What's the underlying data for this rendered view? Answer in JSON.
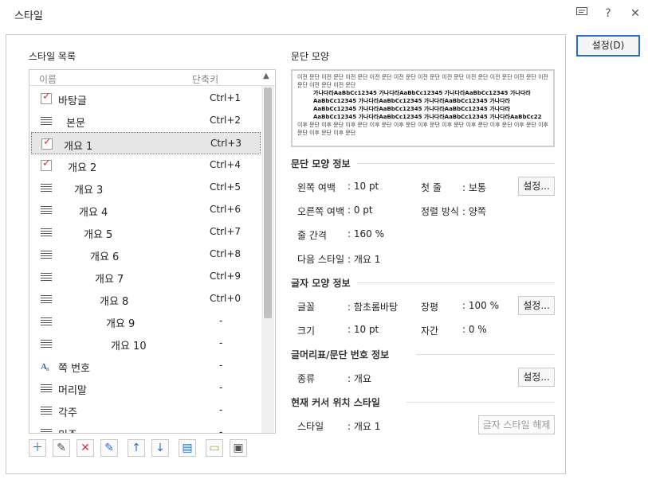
{
  "window": {
    "title": "스타일",
    "help_label": "?",
    "close_label": "✕"
  },
  "ok_button": "설정(D)",
  "style_list": {
    "heading": "스타일 목록",
    "col_name": "이름",
    "col_shortcut": "단축키",
    "items": [
      {
        "name": "바탕글",
        "shortcut": "Ctrl+1",
        "icon": "checkbox-icon"
      },
      {
        "name": "본문",
        "shortcut": "Ctrl+2",
        "icon": "paragraph-icon"
      },
      {
        "name": "개요 1",
        "shortcut": "Ctrl+3",
        "icon": "checkbox-icon",
        "selected": true
      },
      {
        "name": "개요 2",
        "shortcut": "Ctrl+4",
        "icon": "checkbox-icon"
      },
      {
        "name": "개요 3",
        "shortcut": "Ctrl+5",
        "icon": "paragraph-icon"
      },
      {
        "name": "개요 4",
        "shortcut": "Ctrl+6",
        "icon": "paragraph-icon"
      },
      {
        "name": "개요 5",
        "shortcut": "Ctrl+7",
        "icon": "paragraph-icon"
      },
      {
        "name": "개요 6",
        "shortcut": "Ctrl+8",
        "icon": "paragraph-icon"
      },
      {
        "name": "개요 7",
        "shortcut": "Ctrl+9",
        "icon": "paragraph-icon"
      },
      {
        "name": "개요 8",
        "shortcut": "Ctrl+0",
        "icon": "paragraph-icon"
      },
      {
        "name": "개요 9",
        "shortcut": "-",
        "icon": "paragraph-icon"
      },
      {
        "name": "개요 10",
        "shortcut": "-",
        "icon": "paragraph-icon"
      },
      {
        "name": "쪽 번호",
        "shortcut": "-",
        "icon": "char-style-icon"
      },
      {
        "name": "머리말",
        "shortcut": "-",
        "icon": "paragraph-icon"
      },
      {
        "name": "각주",
        "shortcut": "-",
        "icon": "paragraph-icon"
      },
      {
        "name": "미주",
        "shortcut": "-",
        "icon": "paragraph-icon"
      }
    ]
  },
  "toolbar": {
    "add": "＋",
    "edit": "✎",
    "delete": "✕",
    "replace": "✎",
    "up": "↑",
    "down": "↓",
    "import": "▤",
    "open": "▭",
    "save": "▣"
  },
  "preview": {
    "heading": "문단 모양",
    "text_before": "이전 문단 이전 문단 이전 문단 이전 문단 이전 문단 이전 문단 이전 문단 이전 문단 이전 문단 이전 문단 이전 문단 이전 문단 이전 문단",
    "sample": "가나다라AaBbCc12345 가나다라AaBbCc12345 가나다라AaBbCc12345 가나다라AaBbCc12345 가나다라AaBbCc12345 가나다라AaBbCc12345 가나다라AaBbCc12345 가나다라AaBbCc12345 가나다라AaBbCc12345 가나다라AaBbCc12345 가나다라AaBbCc12345 가나다라AaBbCc12345 가나다라AaBbCc22",
    "text_after": "이후 문단 이후 문단 이후 문단 이후 문단 이후 문단 이후 문단 이후 문단 이후 문단 이후 문단 이후 문단 이후 문단 이후 문단 이후 문단"
  },
  "para_info": {
    "heading": "문단 모양 정보",
    "left_margin_label": "왼쪽 여백",
    "left_margin": ": 10 pt",
    "first_line_label": "첫 줄",
    "first_line": ": 보통",
    "right_margin_label": "오른쪽 여백",
    "right_margin": ": 0 pt",
    "align_label": "정렬 방식",
    "align": ": 양쪽",
    "line_spacing_label": "줄 간격",
    "line_spacing": ": 160 %",
    "next_style_label": "다음 스타일",
    "next_style": ": 개요 1",
    "settings_button": "설정..."
  },
  "char_info": {
    "heading": "글자 모양 정보",
    "font_label": "글꼴",
    "font": ": 함초롬바탕",
    "ratio_label": "장평",
    "ratio": ": 100 %",
    "size_label": "크기",
    "size": ": 10 pt",
    "spacing_label": "자간",
    "spacing": ": 0 %",
    "settings_button": "설정..."
  },
  "numbering_info": {
    "heading": "글머리표/문단 번호 정보",
    "type_label": "종류",
    "type": ": 개요",
    "settings_button": "설정..."
  },
  "cursor_style": {
    "heading": "현재 커서 위치 스타일",
    "style_label": "스타일",
    "style": ": 개요 1",
    "clear_button": "글자 스타일 해제"
  },
  "colors": {
    "accent": "#2b6cc4",
    "check_red": "#dd3333",
    "selection": "#e6e6e6"
  }
}
